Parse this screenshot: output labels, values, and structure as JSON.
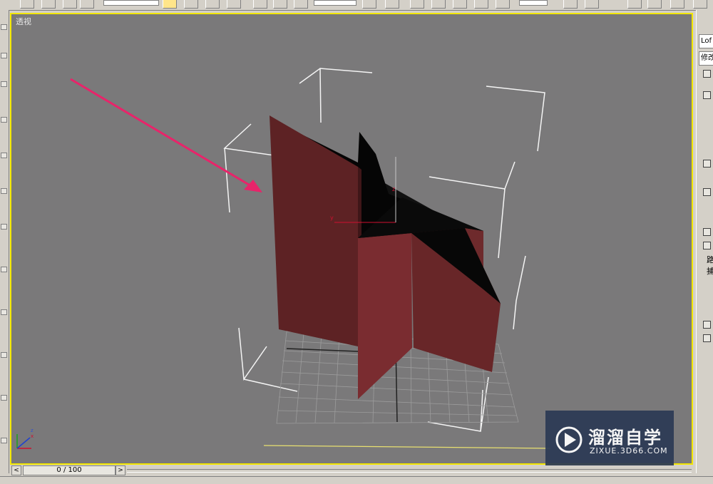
{
  "toolbar": {
    "buttons": [
      "select-filter",
      "select-link",
      "unlink",
      "bind-space-warp",
      "selection-filter",
      "select-object",
      "select-by-name",
      "select-region",
      "window-crossing",
      "select-move",
      "select-rotate",
      "select-scale",
      "reference-coord",
      "pivot",
      "manipulate",
      "keyboard-shortcut",
      "snaps",
      "angle-snap",
      "percent-snap",
      "spinner-snap",
      "named-selection",
      "mirror",
      "align",
      "layers",
      "curve-editor",
      "schematic",
      "material-editor",
      "render-setup",
      "render"
    ],
    "active_tool": "select-object"
  },
  "viewport": {
    "label": "透视",
    "border_color": "#f2e600",
    "background": "#7a797a",
    "axes": {
      "x": "x",
      "y": "y",
      "z": "z"
    },
    "object": {
      "type": "loft star extrusion",
      "color": "#6e2a2c",
      "dark_color": "#5a2224"
    },
    "annotation": {
      "type": "arrow",
      "color": "#e8246a"
    }
  },
  "command_panel": {
    "object_name": "Lof",
    "modifier_list": "修改",
    "section_chars": [
      "路",
      "捕"
    ]
  },
  "timeline": {
    "frame_display": "0 / 100",
    "prev_icon": "<",
    "next_icon": ">"
  },
  "watermark": {
    "brand": "溜溜自学",
    "url": "ZIXUE.3D66.COM",
    "logo_icon": "play-icon"
  }
}
